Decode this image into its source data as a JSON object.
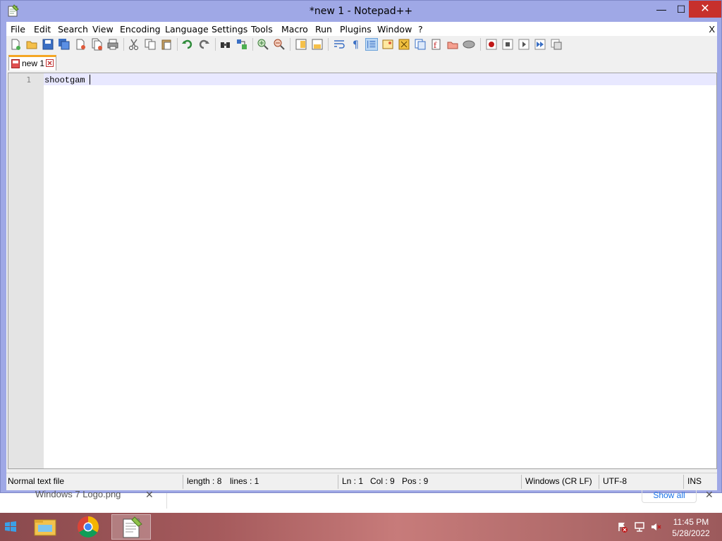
{
  "window": {
    "title": "*new 1 - Notepad++",
    "minimize_glyph": "—",
    "maximize_glyph": "☐",
    "close_glyph": "✕"
  },
  "menu": {
    "items": [
      "File",
      "Edit",
      "Search",
      "View",
      "Encoding",
      "Language",
      "Settings",
      "Tools",
      "Macro",
      "Run",
      "Plugins",
      "Window",
      "?"
    ],
    "close_label": "X"
  },
  "toolbar": {
    "icons": [
      "new-file-icon",
      "open-file-icon",
      "save-icon",
      "save-all-icon",
      "close-icon",
      "close-all-icon",
      "print-icon",
      "cut-icon",
      "copy-icon",
      "paste-icon",
      "undo-icon",
      "redo-icon",
      "find-icon",
      "replace-icon",
      "zoom-in-icon",
      "zoom-out-icon",
      "sync-vertical-icon",
      "sync-horizontal-icon",
      "word-wrap-icon",
      "show-all-chars-icon",
      "indent-guide-icon",
      "user-language-icon",
      "document-map-icon",
      "function-list-icon",
      "folder-workspace-icon",
      "monitoring-icon",
      "record-macro-icon",
      "stop-macro-icon",
      "play-macro-icon",
      "run-macro-multiple-icon",
      "save-macro-icon"
    ]
  },
  "tab": {
    "label": "new 1"
  },
  "editor": {
    "line_number": "1",
    "text": "shootgam"
  },
  "status": {
    "file_type": "Normal text file",
    "length": "length : 8",
    "lines": "lines : 1",
    "ln": "Ln : 1",
    "col": "Col : 9",
    "pos": "Pos : 9",
    "eol": "Windows (CR LF)",
    "encoding": "UTF-8",
    "mode": "INS"
  },
  "download_bar": {
    "file": "Windows 7 Logo.png",
    "show_all": "Show all",
    "close_glyph": "✕"
  },
  "taskbar": {
    "apps": [
      "file-explorer-icon",
      "chrome-icon",
      "notepadpp-icon"
    ],
    "tray": [
      "action-center-icon",
      "network-icon",
      "volume-muted-icon"
    ],
    "time": "11:45 PM",
    "date": "5/28/2022"
  }
}
